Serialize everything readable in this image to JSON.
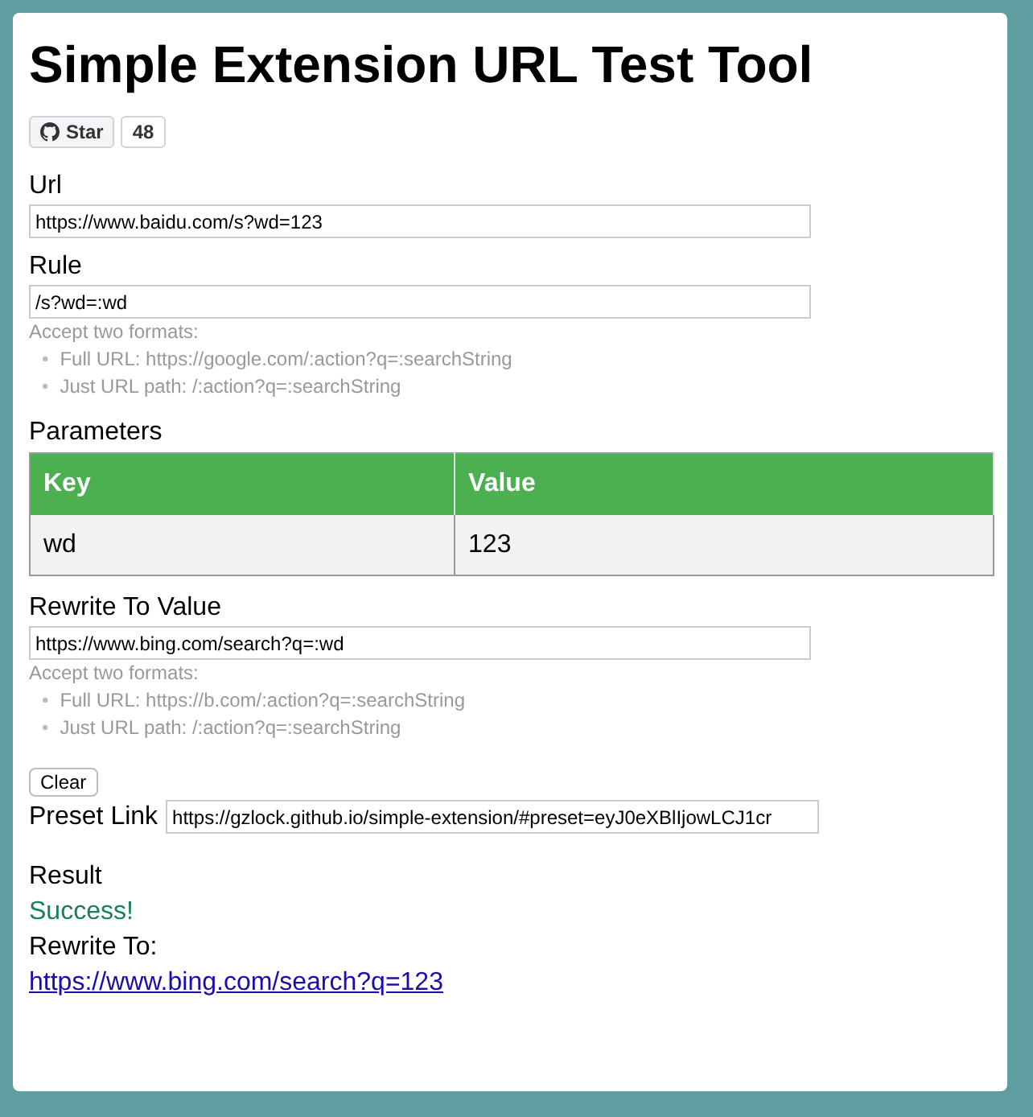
{
  "title": "Simple Extension URL Test Tool",
  "github": {
    "label": "Star",
    "count": "48"
  },
  "url": {
    "label": "Url",
    "value": "https://www.baidu.com/s?wd=123"
  },
  "rule": {
    "label": "Rule",
    "value": "/s?wd=:wd",
    "help": "Accept two formats:",
    "bullet": "•",
    "formats": [
      "Full URL: https://google.com/:action?q=:searchString",
      "Just URL path: /:action?q=:searchString"
    ]
  },
  "parameters": {
    "label": "Parameters",
    "columns": [
      "Key",
      "Value"
    ],
    "rows": [
      [
        "wd",
        "123"
      ]
    ]
  },
  "rewrite": {
    "label": "Rewrite To Value",
    "value": "https://www.bing.com/search?q=:wd",
    "help": "Accept two formats:",
    "bullet": "•",
    "formats": [
      "Full URL: https://b.com/:action?q=:searchString",
      "Just URL path: /:action?q=:searchString"
    ]
  },
  "clear_button": "Clear",
  "preset": {
    "label": "Preset Link",
    "value": "https://gzlock.github.io/simple-extension/#preset=eyJ0eXBlIjowLCJ1cr"
  },
  "result": {
    "label": "Result",
    "status": "Success!",
    "rewrite_label": "Rewrite To:",
    "link": "https://www.bing.com/search?q=123"
  }
}
